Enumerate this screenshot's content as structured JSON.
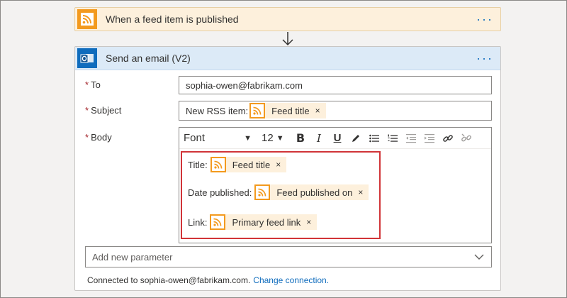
{
  "trigger": {
    "title": "When a feed item is published",
    "icon": "rss-icon",
    "more": "···"
  },
  "action": {
    "title": "Send an email (V2)",
    "icon": "outlook-icon",
    "more": "···",
    "fields": {
      "to": {
        "label": "To",
        "value": "sophia-owen@fabrikam.com"
      },
      "subject": {
        "label": "Subject",
        "prefix": "New RSS item:",
        "token": "Feed title"
      },
      "body": {
        "label": "Body"
      }
    },
    "required_mark": "*",
    "toolbar": {
      "font": "Font",
      "size": "12",
      "bold": "B",
      "italic": "I",
      "underline": "U"
    },
    "body_lines": [
      {
        "label": "Title:",
        "token": "Feed title"
      },
      {
        "label": "Date published:",
        "token": "Feed published on"
      },
      {
        "label": "Link:",
        "token": "Primary feed link"
      }
    ],
    "add_parameter": "Add new parameter",
    "connected_text": "Connected to sophia-owen@fabrikam.com.",
    "change_connection": "Change connection."
  },
  "token_remove": "×",
  "colors": {
    "rss_orange": "#f39a1e",
    "trigger_bg": "#fdf0dc",
    "action_header_bg": "#dceaf7",
    "link_blue": "#0f6cbd",
    "highlight_red": "#d13438",
    "required_red": "#a4262c"
  }
}
